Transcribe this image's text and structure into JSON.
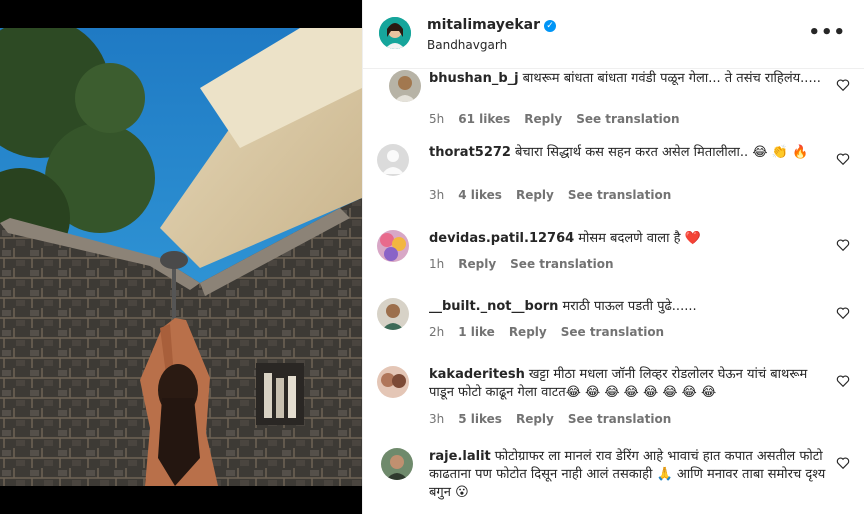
{
  "post": {
    "username": "mitalimayekar",
    "location": "Bandhavgarh"
  },
  "comments": [
    {
      "user": "bhushan_b_j",
      "text": "बाथरूम बांधता बांधता गवंडी पळून गेला... ते तसंच राहिलंय.....",
      "time": "5h",
      "likes": "61 likes",
      "reply": "Reply",
      "translate": "See translation"
    },
    {
      "user": "thorat5272",
      "text": "बेचारा सिद्धार्थ कस सहन करत असेल मितालीला.. 😂 👏 🔥",
      "time": "3h",
      "likes": "4 likes",
      "reply": "Reply",
      "translate": "See translation"
    },
    {
      "user": "devidas.patil.12764",
      "text": "मोसम बदलणे वाला है ❤️",
      "time": "1h",
      "likes": "",
      "reply": "Reply",
      "translate": "See translation"
    },
    {
      "user": "__built._not__born",
      "text": "मराठी पाऊल पडती पुढे......",
      "time": "2h",
      "likes": "1 like",
      "reply": "Reply",
      "translate": "See translation"
    },
    {
      "user": "kakaderitesh",
      "text": "खट्टा मीठा मधला जॉनी लिव्हर रोडलोलर घेऊन यांचं बाथरूम पाडून फोटो काढून गेला वाटत😂 😂 😂 😂 😂 😂 😂 😂",
      "time": "3h",
      "likes": "5 likes",
      "reply": "Reply",
      "translate": "See translation"
    },
    {
      "user": "raje.lalit",
      "text": "फोटोग्राफर ला मानलं राव डेरिंग आहे भावाचं हात कपात असतील फोटो काढताना पण फोटोत दिसून नाही आलं तसकाही 🙏 आणि मनावर ताबा समोरच दृश्य बगुन 😮",
      "time": "",
      "likes": "",
      "reply": "",
      "translate": ""
    }
  ]
}
